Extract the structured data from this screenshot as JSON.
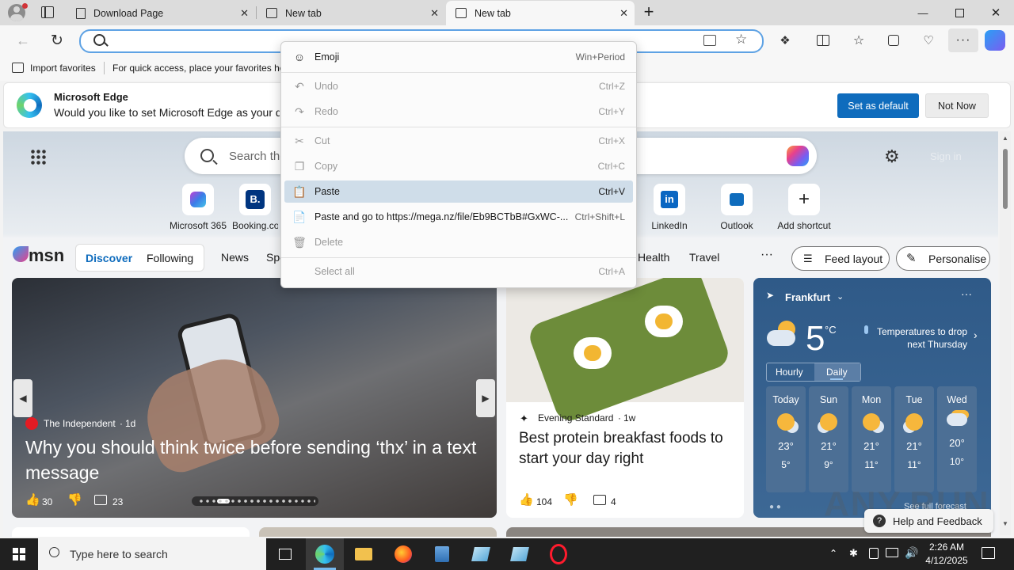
{
  "tabs": [
    {
      "title": "Download Page"
    },
    {
      "title": "New tab"
    },
    {
      "title": "New tab"
    }
  ],
  "favorites_bar": {
    "import": "Import favorites",
    "hint": "For quick access, place your favorites here"
  },
  "banner": {
    "title": "Microsoft Edge",
    "message": "Would you like to set Microsoft Edge as your default browser?",
    "set_default": "Set as default",
    "not_now": "Not Now"
  },
  "ntp": {
    "search_placeholder": "Search the web",
    "sign_in": "Sign in",
    "shortcuts": [
      {
        "label": "Microsoft 365"
      },
      {
        "label": "Booking.com"
      },
      {
        "label": "LinkedIn"
      },
      {
        "label": "Outlook"
      },
      {
        "label": "Add shortcut"
      }
    ]
  },
  "msn": {
    "logo": "msn",
    "tabs": [
      "Discover",
      "Following"
    ],
    "nav": [
      "News",
      "Sports",
      "Health",
      "Travel"
    ],
    "feed_layout": "Feed layout",
    "personalise": "Personalise"
  },
  "hero": {
    "source": "The Independent",
    "age": "1d",
    "headline": "Why you should think twice before sending ‘thx’ in a text message",
    "likes": "30",
    "comments": "23"
  },
  "article": {
    "source": "Evening Standard",
    "age": "1w",
    "headline": "Best protein breakfast foods to start your day right",
    "likes": "104",
    "comments": "4"
  },
  "weather": {
    "city": "Frankfurt",
    "temp": "5",
    "unit": "°C",
    "note": "Temperatures to drop next Thursday",
    "tab_hourly": "Hourly",
    "tab_daily": "Daily",
    "days": [
      {
        "name": "Today",
        "hi": "23°",
        "lo": "5°"
      },
      {
        "name": "Sun",
        "hi": "21°",
        "lo": "9°"
      },
      {
        "name": "Mon",
        "hi": "21°",
        "lo": "11°"
      },
      {
        "name": "Tue",
        "hi": "21°",
        "lo": "11°"
      },
      {
        "name": "Wed",
        "hi": "20°",
        "lo": "10°"
      }
    ],
    "forecast_link": "See full forecast"
  },
  "help": "Help and Feedback",
  "watermark": "ANY.RUN",
  "context_menu": {
    "items": [
      {
        "label": "Emoji",
        "shortcut": "Win+Period"
      },
      {
        "label": "Undo",
        "shortcut": "Ctrl+Z"
      },
      {
        "label": "Redo",
        "shortcut": "Ctrl+Y"
      },
      {
        "label": "Cut",
        "shortcut": "Ctrl+X"
      },
      {
        "label": "Copy",
        "shortcut": "Ctrl+C"
      },
      {
        "label": "Paste",
        "shortcut": "Ctrl+V"
      },
      {
        "label": "Paste and go to https://mega.nz/file/Eb9BCTbB#GxWC-...",
        "shortcut": "Ctrl+Shift+L"
      },
      {
        "label": "Delete",
        "shortcut": ""
      },
      {
        "label": "Select all",
        "shortcut": "Ctrl+A"
      }
    ]
  },
  "taskbar": {
    "search_placeholder": "Type here to search",
    "time": "2:26 AM",
    "date": "4/12/2025"
  },
  "colors": {
    "accent": "#0f6cbd",
    "address_focus": "#5ea2e4",
    "highlight": "#cfdde9",
    "taskbar": "#202020"
  }
}
